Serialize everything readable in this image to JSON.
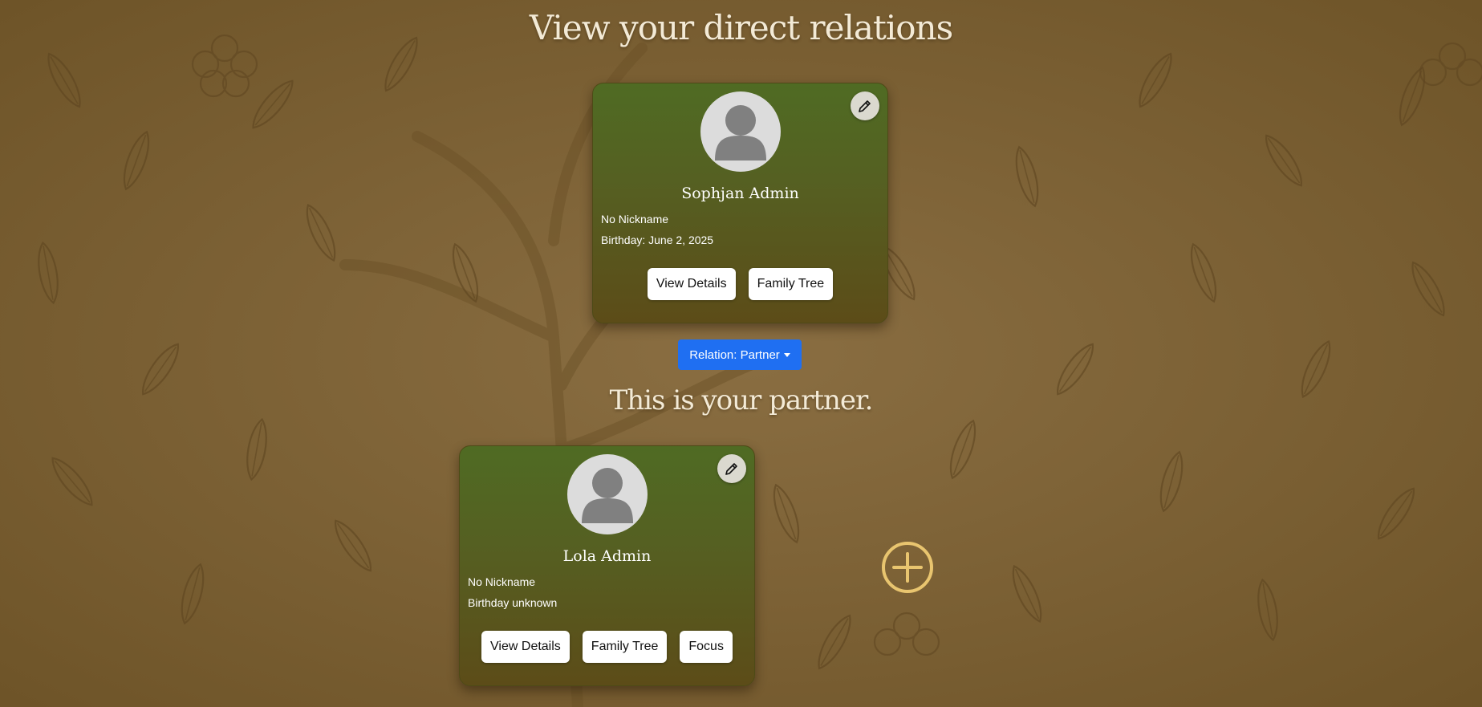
{
  "header": {
    "title": "View your direct relations"
  },
  "main_person": {
    "name": "Sophjan Admin",
    "nickname": "No Nickname",
    "birthday": "Birthday: June 2, 2025",
    "buttons": {
      "view_details": "View Details",
      "family_tree": "Family Tree"
    }
  },
  "relation_dropdown": {
    "label": "Relation: Partner"
  },
  "relation_section": {
    "title": "This is your partner."
  },
  "partner": {
    "name": "Lola Admin",
    "nickname": "No Nickname",
    "birthday": "Birthday unknown",
    "buttons": {
      "view_details": "View Details",
      "family_tree": "Family Tree",
      "focus": "Focus"
    }
  },
  "icons": {
    "avatar": "user-silhouette-icon",
    "edit": "pencil-icon",
    "add": "plus-circle-icon",
    "dropdown": "caret-down-icon"
  },
  "colors": {
    "accent": "#1f6ff2",
    "card_top": "#4f6b23",
    "card_bottom": "#5c4c18",
    "add_icon": "#e9c56f",
    "title_text": "#f3ead6"
  }
}
